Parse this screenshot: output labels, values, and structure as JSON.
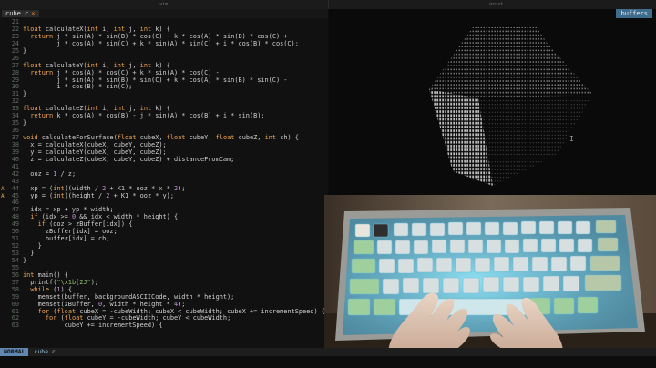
{
  "window": {
    "left_title": "vim",
    "right_title": "...ocust"
  },
  "editor": {
    "file_tab": "cube.c",
    "close_glyph": "×"
  },
  "right_pane": {
    "buffers_label": "buffers"
  },
  "status": {
    "mode": "NORMAL",
    "filename": "cube.c"
  },
  "code": [
    {
      "n": "21",
      "t": ""
    },
    {
      "n": "22",
      "t": "float calculateX(int i, int j, int k) {"
    },
    {
      "n": "23",
      "t": "  return j * sin(A) * sin(B) * cos(C) - k * cos(A) * sin(B) * cos(C) +"
    },
    {
      "n": "24",
      "t": "         j * cos(A) * sin(C) + k * sin(A) * sin(C) + i * cos(B) * cos(C);"
    },
    {
      "n": "25",
      "t": "}"
    },
    {
      "n": "26",
      "t": ""
    },
    {
      "n": "27",
      "t": "float calculateY(int i, int j, int k) {"
    },
    {
      "n": "28",
      "t": "  return j * cos(A) * cos(C) + k * sin(A) * cos(C) -"
    },
    {
      "n": "29",
      "t": "         j * sin(A) * sin(B) * sin(C) + k * cos(A) * sin(B) * sin(C) -"
    },
    {
      "n": "30",
      "t": "         i * cos(B) * sin(C);"
    },
    {
      "n": "31",
      "t": "}"
    },
    {
      "n": "32",
      "t": ""
    },
    {
      "n": "33",
      "t": "float calculateZ(int i, int j, int k) {"
    },
    {
      "n": "34",
      "t": "  return k * cos(A) * cos(B) - j * sin(A) * cos(B) + i * sin(B);"
    },
    {
      "n": "35",
      "t": "}"
    },
    {
      "n": "36",
      "t": ""
    },
    {
      "n": "37",
      "t": "void calculateForSurface(float cubeX, float cubeY, float cubeZ, int ch) {"
    },
    {
      "n": "38",
      "t": "  x = calculateX(cubeX, cubeY, cubeZ);"
    },
    {
      "n": "39",
      "t": "  y = calculateY(cubeX, cubeY, cubeZ);"
    },
    {
      "n": "40",
      "t": "  z = calculateZ(cubeX, cubeY, cubeZ) + distanceFromCam;"
    },
    {
      "n": "41",
      "t": ""
    },
    {
      "n": "42",
      "t": "  ooz = 1 / z;"
    },
    {
      "n": "43",
      "t": ""
    },
    {
      "n": "44",
      "t": "  xp = (int)(width / 2 + K1 * ooz * x * 2);",
      "mark": "A"
    },
    {
      "n": "45",
      "t": "  yp = (int)(height / 2 + K1 * ooz * y);",
      "mark": "A"
    },
    {
      "n": "46",
      "t": ""
    },
    {
      "n": "47",
      "t": "  idx = xp + yp * width;"
    },
    {
      "n": "48",
      "t": "  if (idx >= 0 && idx < width * height) {"
    },
    {
      "n": "49",
      "t": "    if (ooz > zBuffer[idx]) {"
    },
    {
      "n": "50",
      "t": "      zBuffer[idx] = ooz;"
    },
    {
      "n": "51",
      "t": "      buffer[idx] = ch;"
    },
    {
      "n": "52",
      "t": "    }"
    },
    {
      "n": "53",
      "t": "  }"
    },
    {
      "n": "54",
      "t": "}"
    },
    {
      "n": "55",
      "t": ""
    },
    {
      "n": "56",
      "t": "int main() {"
    },
    {
      "n": "57",
      "t": "  printf(\"\\x1b[2J\");"
    },
    {
      "n": "58",
      "t": "  while (1) {"
    },
    {
      "n": "59",
      "t": "    memset(buffer, backgroundASCIICode, width * height);"
    },
    {
      "n": "60",
      "t": "    memset(zBuffer, 0, width * height * 4);"
    },
    {
      "n": "61",
      "t": "    for (float cubeX = -cubeWidth; cubeX < cubeWidth; cubeX += incrementSpeed) {"
    },
    {
      "n": "62",
      "t": "      for (float cubeY = -cubeWidth; cubeY < cubeWidth;"
    },
    {
      "n": "63",
      "t": "           cubeY += incrementSpeed) {"
    }
  ],
  "colors": {
    "keyword": "#f0a451",
    "number": "#c48fe0",
    "string": "#8fbf6a",
    "mode_bg": "#5f87af",
    "buffers_bg": "#3d6c8c"
  }
}
